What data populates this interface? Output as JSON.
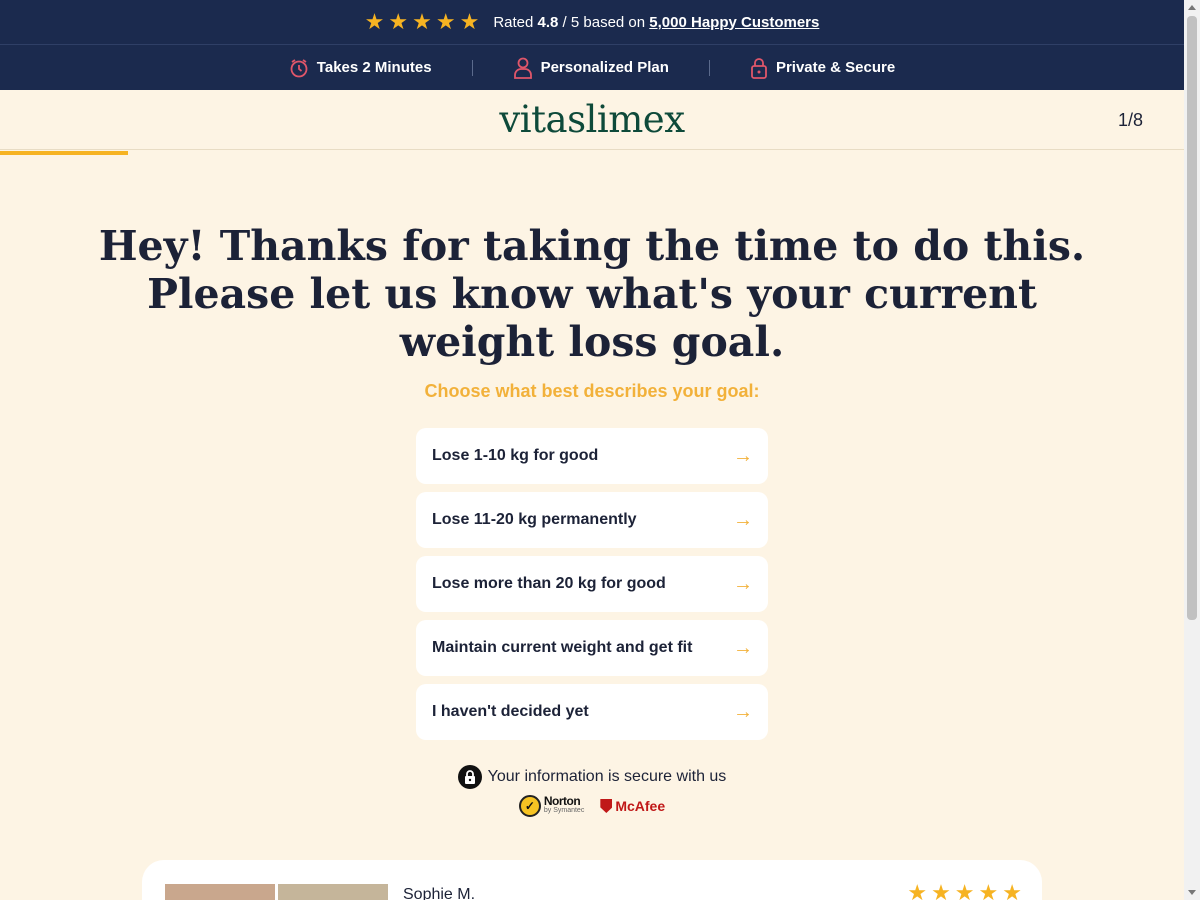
{
  "rating_bar": {
    "stars": 5,
    "rated_prefix": "Rated ",
    "rating_value": "4.8",
    "rating_suffix": " / 5 based on ",
    "customers_link": "5,000 Happy Customers"
  },
  "features": [
    {
      "label": "Takes 2 Minutes",
      "icon": "alarm-clock-icon"
    },
    {
      "label": "Personalized Plan",
      "icon": "person-icon"
    },
    {
      "label": "Private & Secure",
      "icon": "lock-icon"
    }
  ],
  "header": {
    "logo": "vitaslimex",
    "step": "1/8",
    "progress": 0.125
  },
  "question": {
    "headline": "Hey! Thanks for taking the time to do this. Please let us know what's your current weight loss goal.",
    "prompt": "Choose what best describes your goal:"
  },
  "options": [
    {
      "label": "Lose 1-10 kg for good"
    },
    {
      "label": "Lose 11-20 kg permanently"
    },
    {
      "label": "Lose more than 20 kg for good"
    },
    {
      "label": "Maintain current weight and get fit"
    },
    {
      "label": "I haven't decided yet"
    }
  ],
  "secure": {
    "text": "Your information is secure with us",
    "norton_name": "Norton",
    "norton_sub": "by Symantec",
    "mcafee_name": "McAfee"
  },
  "review": {
    "name": "Sophie M.",
    "stars": 5
  },
  "colors": {
    "navy": "#1b2a4e",
    "cream": "#fdf4e4",
    "accent": "#f6b322",
    "logo_green": "#0e4a3a"
  }
}
